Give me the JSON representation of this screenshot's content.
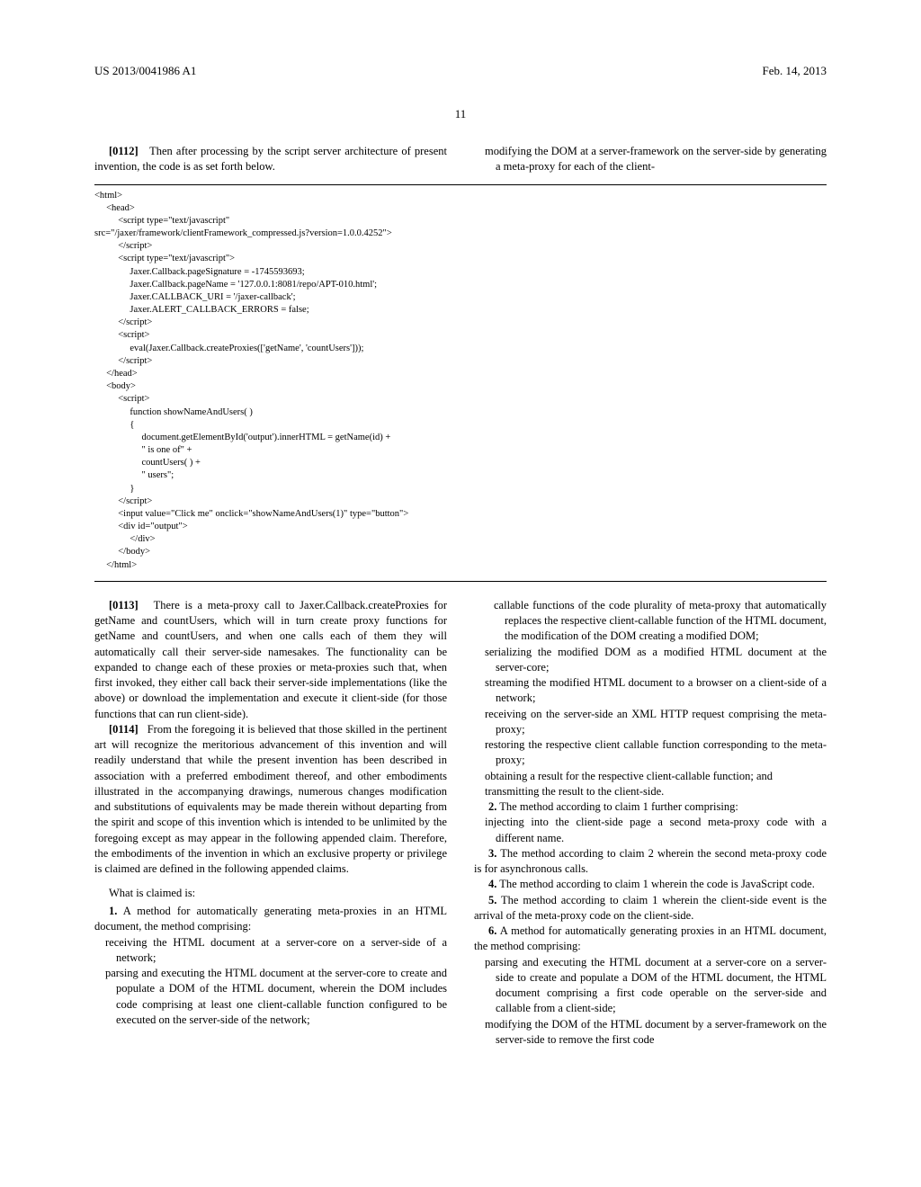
{
  "header": {
    "pub_number": "US 2013/0041986 A1",
    "date": "Feb. 14, 2013",
    "page": "11"
  },
  "top_left_para": {
    "b": "[0112]",
    "text": "Then after processing by the script server architecture of present invention, the code is as set forth below."
  },
  "top_right_para": "modifying the DOM at a server-framework on the server-side by generating a meta-proxy for each of the client-",
  "code": "<html>\n     <head>\n          <script type=\"text/javascript\"\nsrc=\"/jaxer/framework/clientFramework_compressed.js?version=1.0.0.4252\">\n          </script>\n          <script type=\"text/javascript\">\n               Jaxer.Callback.pageSignature = -1745593693;\n               Jaxer.Callback.pageName = '127.0.0.1:8081/repo/APT-010.html';\n               Jaxer.CALLBACK_URI = '/jaxer-callback';\n               Jaxer.ALERT_CALLBACK_ERRORS = false;\n          </script>\n          <script>\n               eval(Jaxer.Callback.createProxies(['getName', 'countUsers']));\n          </script>\n     </head>\n     <body>\n          <script>\n               function showNameAndUsers( )\n               {\n                    document.getElementById('output').innerHTML = getName(id) +\n                    \" is one of\" +\n                    countUsers( ) +\n                    \" users\";\n               }\n          </script>\n          <input value=\"Click me\" onclick=\"showNameAndUsers(1)\" type=\"button\">\n          <div id=\"output\">\n               </div>\n          </body>\n     </html>",
  "col_left": {
    "p113": {
      "b": "[0113]",
      "text": "There is a meta-proxy call to Jaxer.Callback.createProxies for getName and countUsers, which will in turn create proxy functions for getName and countUsers, and when one calls each of them they will automatically call their server-side namesakes. The functionality can be expanded to change each of these proxies or meta-proxies such that, when first invoked, they either call back their server-side implementations (like the above) or download the implementation and execute it client-side (for those functions that can run client-side)."
    },
    "p114": {
      "b": "[0114]",
      "text": "From the foregoing it is believed that those skilled in the pertinent art will recognize the meritorious advancement of this invention and will readily understand that while the present invention has been described in association with a preferred embodiment thereof, and other embodiments illustrated in the accompanying drawings, numerous changes modification and substitutions of equivalents may be made therein without departing from the spirit and scope of this invention which is intended to be unlimited by the foregoing except as may appear in the following appended claim. Therefore, the embodiments of the invention in which an exclusive property or privilege is claimed are defined in the following appended claims."
    },
    "what_is_claimed": "What is claimed is:",
    "claim1_intro": "A method for automatically generating meta-proxies in an HTML document, the method comprising:",
    "claim1_a": "receiving the HTML document at a server-core on a server-side of a network;",
    "claim1_b": "parsing and executing the HTML document at the server-core to create and populate a DOM of the HTML document, wherein the DOM includes code comprising at least one client-callable function configured to be executed on the server-side of the network;"
  },
  "col_right": {
    "cont_a": "callable functions of the code plurality of meta-proxy that automatically replaces the respective client-callable function of the HTML document, the modification of the DOM creating a modified DOM;",
    "cont_b": "serializing the modified DOM as a modified HTML document at the server-core;",
    "cont_c": "streaming the modified HTML document to a browser on a client-side of a network;",
    "cont_d": "receiving on the server-side an XML HTTP request comprising the meta-proxy;",
    "cont_e": "restoring the respective client callable function corresponding to the meta-proxy;",
    "cont_f": "obtaining a result for the respective client-callable function; and",
    "cont_g": "transmitting the result to the client-side.",
    "claim2_intro": "The method according to claim 1 further comprising:",
    "claim2_a": "injecting into the client-side page a second meta-proxy code with a different name.",
    "claim3": "The method according to claim 2 wherein the second meta-proxy code is for asynchronous calls.",
    "claim4": "The method according to claim 1 wherein the code is JavaScript code.",
    "claim5": "The method according to claim 1 wherein the client-side event is the arrival of the meta-proxy code on the client-side.",
    "claim6_intro": "A method for automatically generating proxies in an HTML document, the method comprising:",
    "claim6_a": "parsing and executing the HTML document at a server-core on a server-side to create and populate a DOM of the HTML document, the HTML document comprising a first code operable on the server-side and callable from a client-side;",
    "claim6_b": "modifying the DOM of the HTML document by a server-framework on the server-side to remove the first code"
  },
  "labels": {
    "claim_num_1": "1.",
    "claim_num_2": "2.",
    "claim_num_3": "3.",
    "claim_num_4": "4.",
    "claim_num_5": "5.",
    "claim_num_6": "6."
  }
}
